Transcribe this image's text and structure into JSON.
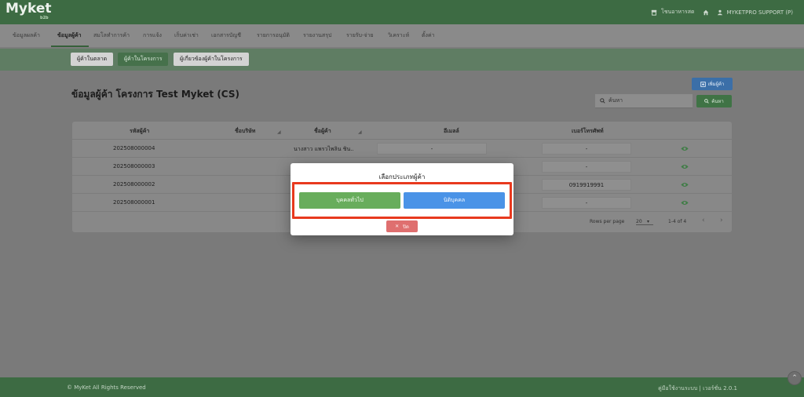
{
  "header": {
    "logo_text": "Myket",
    "logo_sub": "b2b",
    "store_link": "โชนอาหารสด",
    "user_label": "MYKETPRO SUPPORT (P)"
  },
  "menu": [
    "ข้อมูลผลค้า",
    "ข้อมูลผู้ค้า",
    "สมโลทำการค้า",
    "การแจ้ง",
    "เก็บค่าเช่า",
    "เอกสารบัญชี",
    "รายการอนุมัติ",
    "รายงานสรุป",
    "รายรับ-จ่าย",
    "วิเคราะห์",
    "ตั้งค่า"
  ],
  "subtabs": [
    "ผู้ค้าในตลาด",
    "ผู้ค้าในโครงการ",
    "ผู้เกี่ยวข้องผู้ค้าในโครงการ"
  ],
  "page": {
    "title": "ข้อมูลผู้ค้า โครงการ Test Myket (CS)",
    "add_button": "เพิ่มผู้ค้า",
    "search_placeholder": "ค้นหา",
    "search_button": "ค้นหา"
  },
  "table": {
    "headers": [
      "รหัสผู้ค้า",
      "ชื่อบริษัท",
      "ชื่อผู้ค้า",
      "อีเมลล์",
      "เบอร์โทรศัพท์"
    ],
    "rows": [
      {
        "id": "202508000004",
        "company": "",
        "name": "นางสาว แพรวไพลิน ชิน..",
        "email": "-",
        "phone": "-"
      },
      {
        "id": "202508000003",
        "company": "",
        "name": "",
        "email": "",
        "phone": "-"
      },
      {
        "id": "202508000002",
        "company": "",
        "name": "",
        "email": "",
        "phone": "0919919991"
      },
      {
        "id": "202508000001",
        "company": "",
        "name": "",
        "email": "",
        "phone": "-"
      }
    ],
    "rows_per_page_label": "Rows per page",
    "rows_per_page_value": "20",
    "range_label": "1-4 of 4"
  },
  "modal": {
    "title": "เลือกประเภทผู้ค้า",
    "general_button": "บุคคลทั่วไป",
    "juristic_button": "นิติบุคคล",
    "close_button": "ปิด"
  },
  "footer": {
    "copyright": "© MyKet All Rights Reserved",
    "version_text": "คู่มือใช้งานระบบ | เวอร์ชั่น 2.0.1"
  },
  "colors": {
    "brand_green": "#3d6b43",
    "highlight_red": "#e8391e",
    "general_green": "#68ad5c",
    "juristic_blue": "#4a93e7",
    "close_red": "#df6f6f",
    "eye_green": "#3f7d46"
  }
}
